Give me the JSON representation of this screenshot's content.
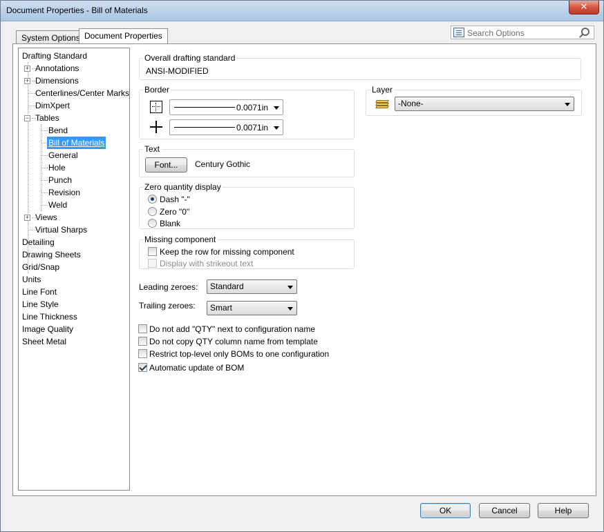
{
  "window": {
    "title": "Document Properties - Bill of Materials",
    "close_glyph": "✕"
  },
  "tabs": [
    {
      "label": "System Options"
    },
    {
      "label": "Document Properties"
    }
  ],
  "search": {
    "placeholder": "Search Options"
  },
  "tree": {
    "items": [
      {
        "label": "Drafting Standard"
      },
      {
        "label": "Annotations"
      },
      {
        "label": "Dimensions"
      },
      {
        "label": "Centerlines/Center Marks"
      },
      {
        "label": "DimXpert"
      },
      {
        "label": "Tables"
      },
      {
        "label": "Bend"
      },
      {
        "label": "Bill of Materials"
      },
      {
        "label": "General"
      },
      {
        "label": "Hole"
      },
      {
        "label": "Punch"
      },
      {
        "label": "Revision"
      },
      {
        "label": "Weld"
      },
      {
        "label": "Views"
      },
      {
        "label": "Virtual Sharps"
      },
      {
        "label": "Detailing"
      },
      {
        "label": "Drawing Sheets"
      },
      {
        "label": "Grid/Snap"
      },
      {
        "label": "Units"
      },
      {
        "label": "Line Font"
      },
      {
        "label": "Line Style"
      },
      {
        "label": "Line Thickness"
      },
      {
        "label": "Image Quality"
      },
      {
        "label": "Sheet Metal"
      }
    ],
    "selected": "Bill of Materials"
  },
  "overall_standard": {
    "label": "Overall drafting standard",
    "value": "ANSI-MODIFIED"
  },
  "border": {
    "label": "Border",
    "outer": {
      "value": "0.0071in"
    },
    "inner": {
      "value": "0.0071in"
    }
  },
  "layer": {
    "label": "Layer",
    "value": "-None-"
  },
  "text": {
    "label": "Text",
    "font_button": "Font...",
    "font_name": "Century Gothic"
  },
  "zero_quantity": {
    "label": "Zero quantity display",
    "options": [
      {
        "label": "Dash \"-\"",
        "checked": true
      },
      {
        "label": "Zero \"0\"",
        "checked": false
      },
      {
        "label": "Blank",
        "checked": false
      }
    ]
  },
  "missing_component": {
    "label": "Missing component",
    "keep_row": {
      "label": "Keep the row for missing component",
      "checked": false
    },
    "strikeout": {
      "label": "Display with strikeout text",
      "checked": false,
      "disabled": true
    }
  },
  "leading_zeroes": {
    "label": "Leading zeroes:",
    "value": "Standard"
  },
  "trailing_zeroes": {
    "label": "Trailing zeroes:",
    "value": "Smart"
  },
  "options": [
    {
      "label": "Do not add \"QTY\" next to configuration name",
      "checked": false
    },
    {
      "label": "Do not copy QTY column name from template",
      "checked": false
    },
    {
      "label": "Restrict top-level only BOMs to one configuration",
      "checked": false
    },
    {
      "label": "Automatic update of BOM",
      "checked": true
    }
  ],
  "footer": {
    "ok": "OK",
    "cancel": "Cancel",
    "help": "Help"
  }
}
